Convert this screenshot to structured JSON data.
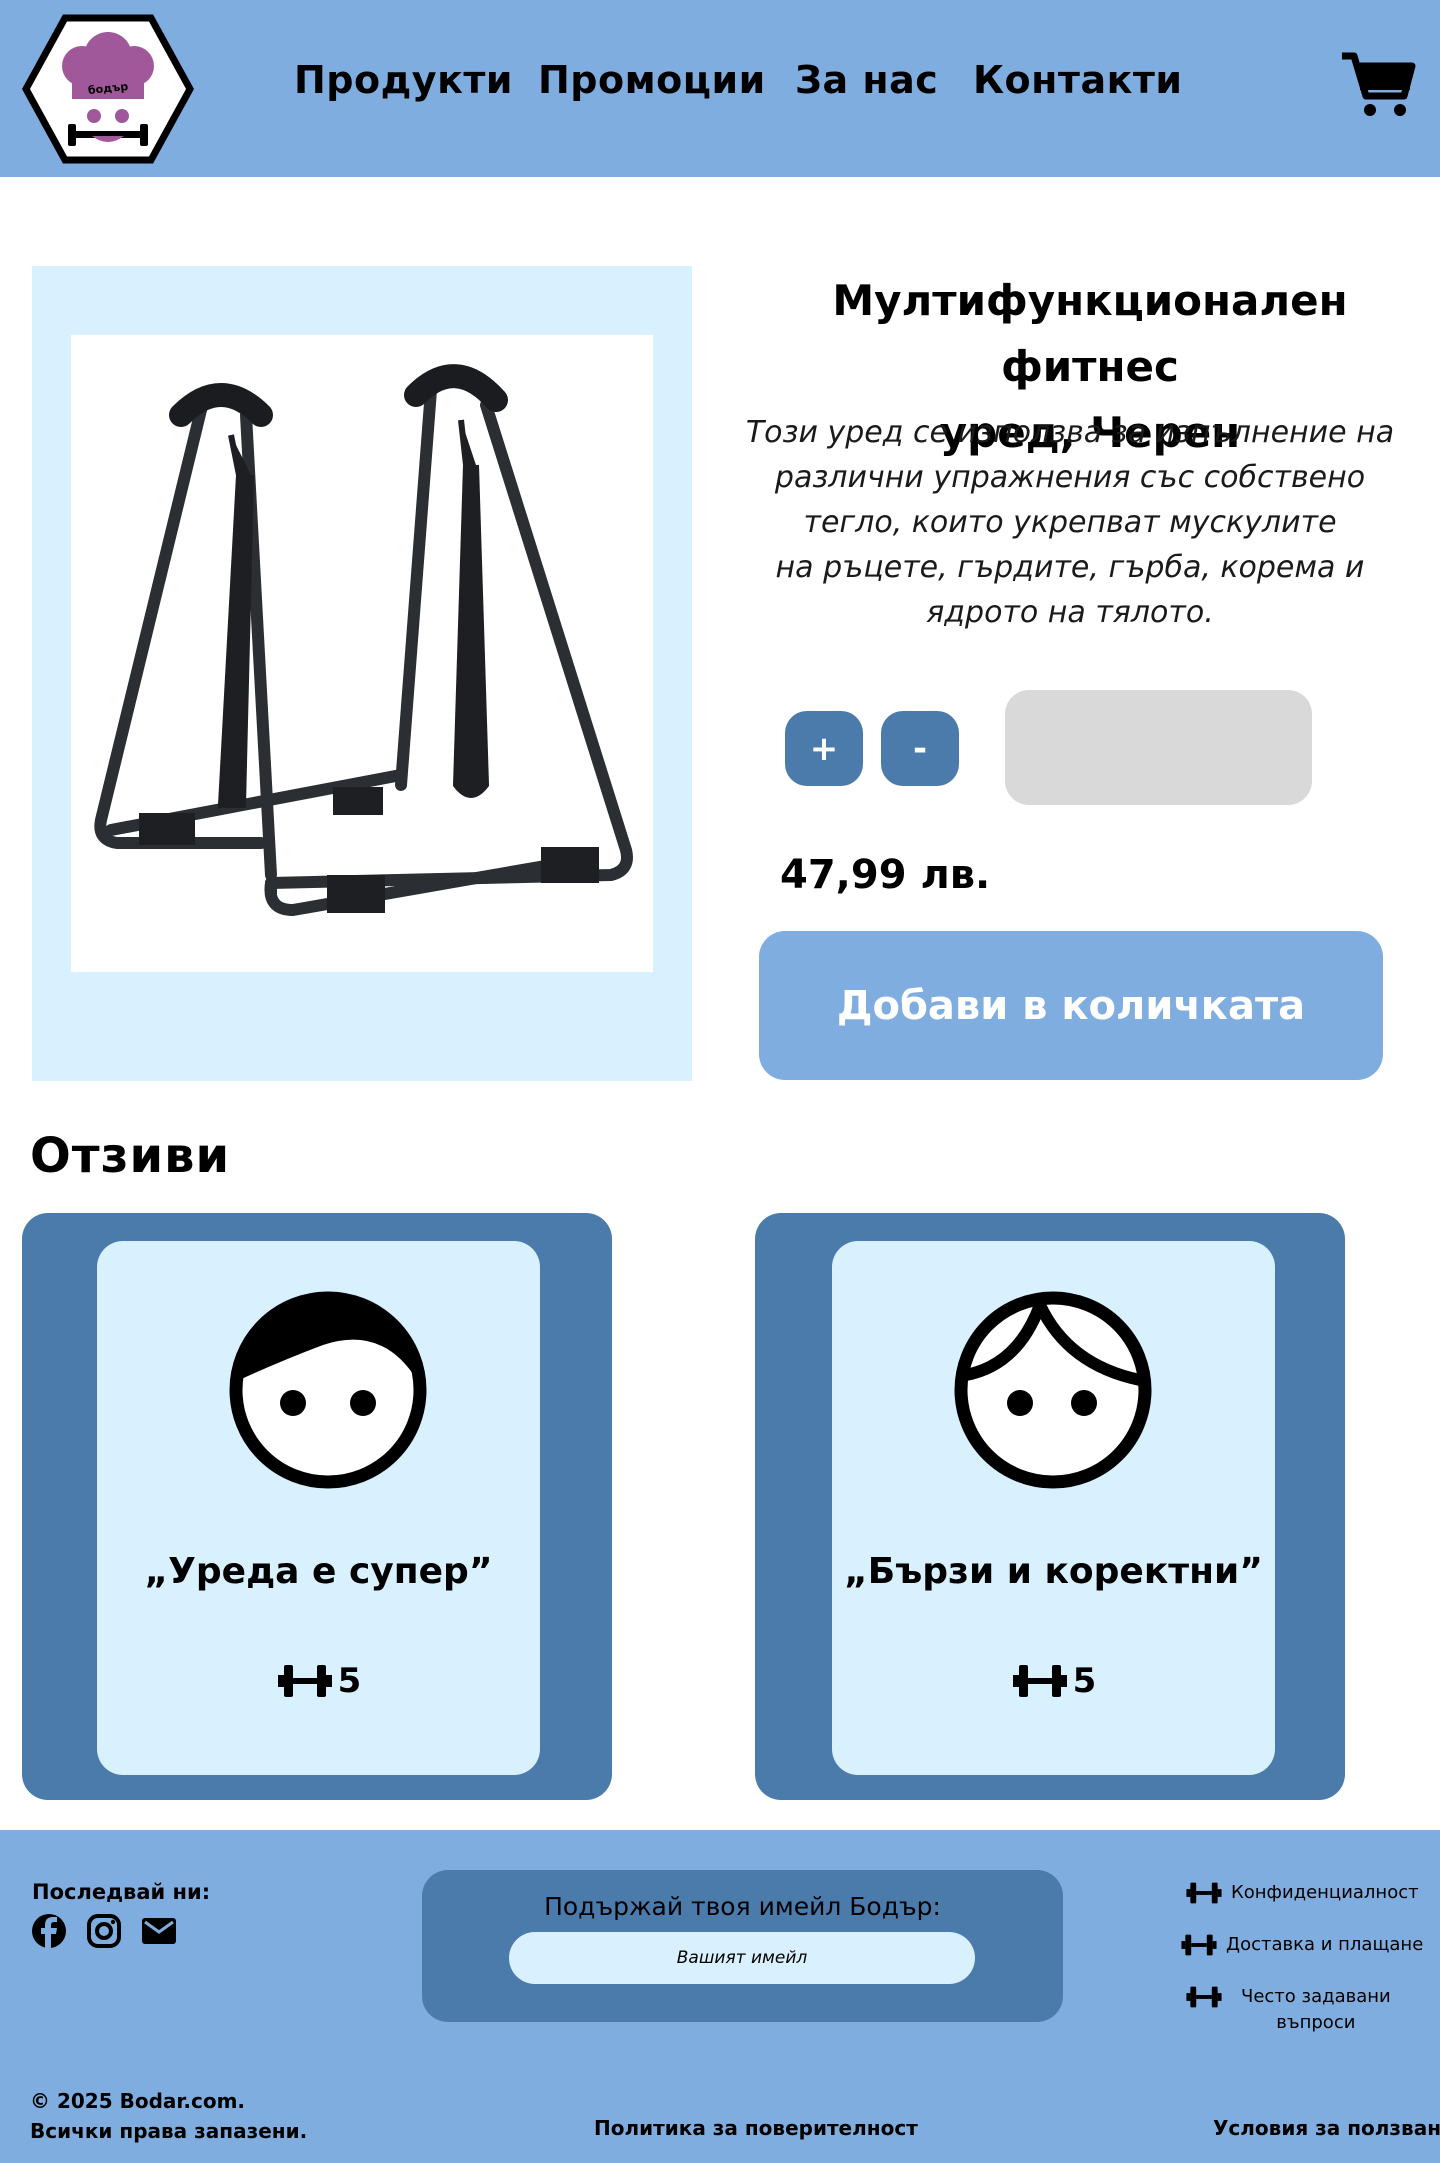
{
  "header": {
    "logo_text": "бодър",
    "nav": [
      "Продукти",
      "Промоции",
      "За нас",
      "Контакти"
    ],
    "cart_icon": "cart-icon"
  },
  "product": {
    "title_line1": "Мултифункционален фитнес",
    "title_line2": "уред, Черен",
    "description": [
      "Този уред се използва за изпълнение на",
      "различни упражнения със собствено",
      "тегло, които укрепват мускулите",
      "на ръцете, гърдите, гърба, корема и",
      "ядрото на тялото."
    ],
    "plus_label": "+",
    "minus_label": "-",
    "quantity_value": "",
    "price": "47,99 лв.",
    "add_to_cart": "Добави в количката"
  },
  "reviews": {
    "title": "Отзиви",
    "items": [
      {
        "text": "„Уреда е супер”",
        "rating": "5",
        "avatar_icon": "boy-face-icon"
      },
      {
        "text": "„Бързи и коректни”",
        "rating": "5",
        "avatar_icon": "face-icon"
      }
    ]
  },
  "footer": {
    "follow_label": "Последвай ни:",
    "social": [
      "facebook-icon",
      "instagram-icon",
      "mail-icon"
    ],
    "newsletter_label": "Подържай твоя имейл Бодър:",
    "email_placeholder": "Вашият имейл",
    "links": [
      "Конфиденциалност",
      "Доставка и плащане",
      "Често задавани",
      "въпроси"
    ],
    "copyright_line1": "© 2025 Bodar.com.",
    "copyright_line2": "Всички права запазени.",
    "privacy_policy": "Политика за поверителност",
    "terms": "Условия за ползване"
  },
  "colors": {
    "header_bg": "#80ADDF",
    "dark_blue": "#4A7BAB",
    "light_blue": "#D9F1FE",
    "qty_field": "#D9D9D9",
    "logo_purple": "#A0589A"
  }
}
